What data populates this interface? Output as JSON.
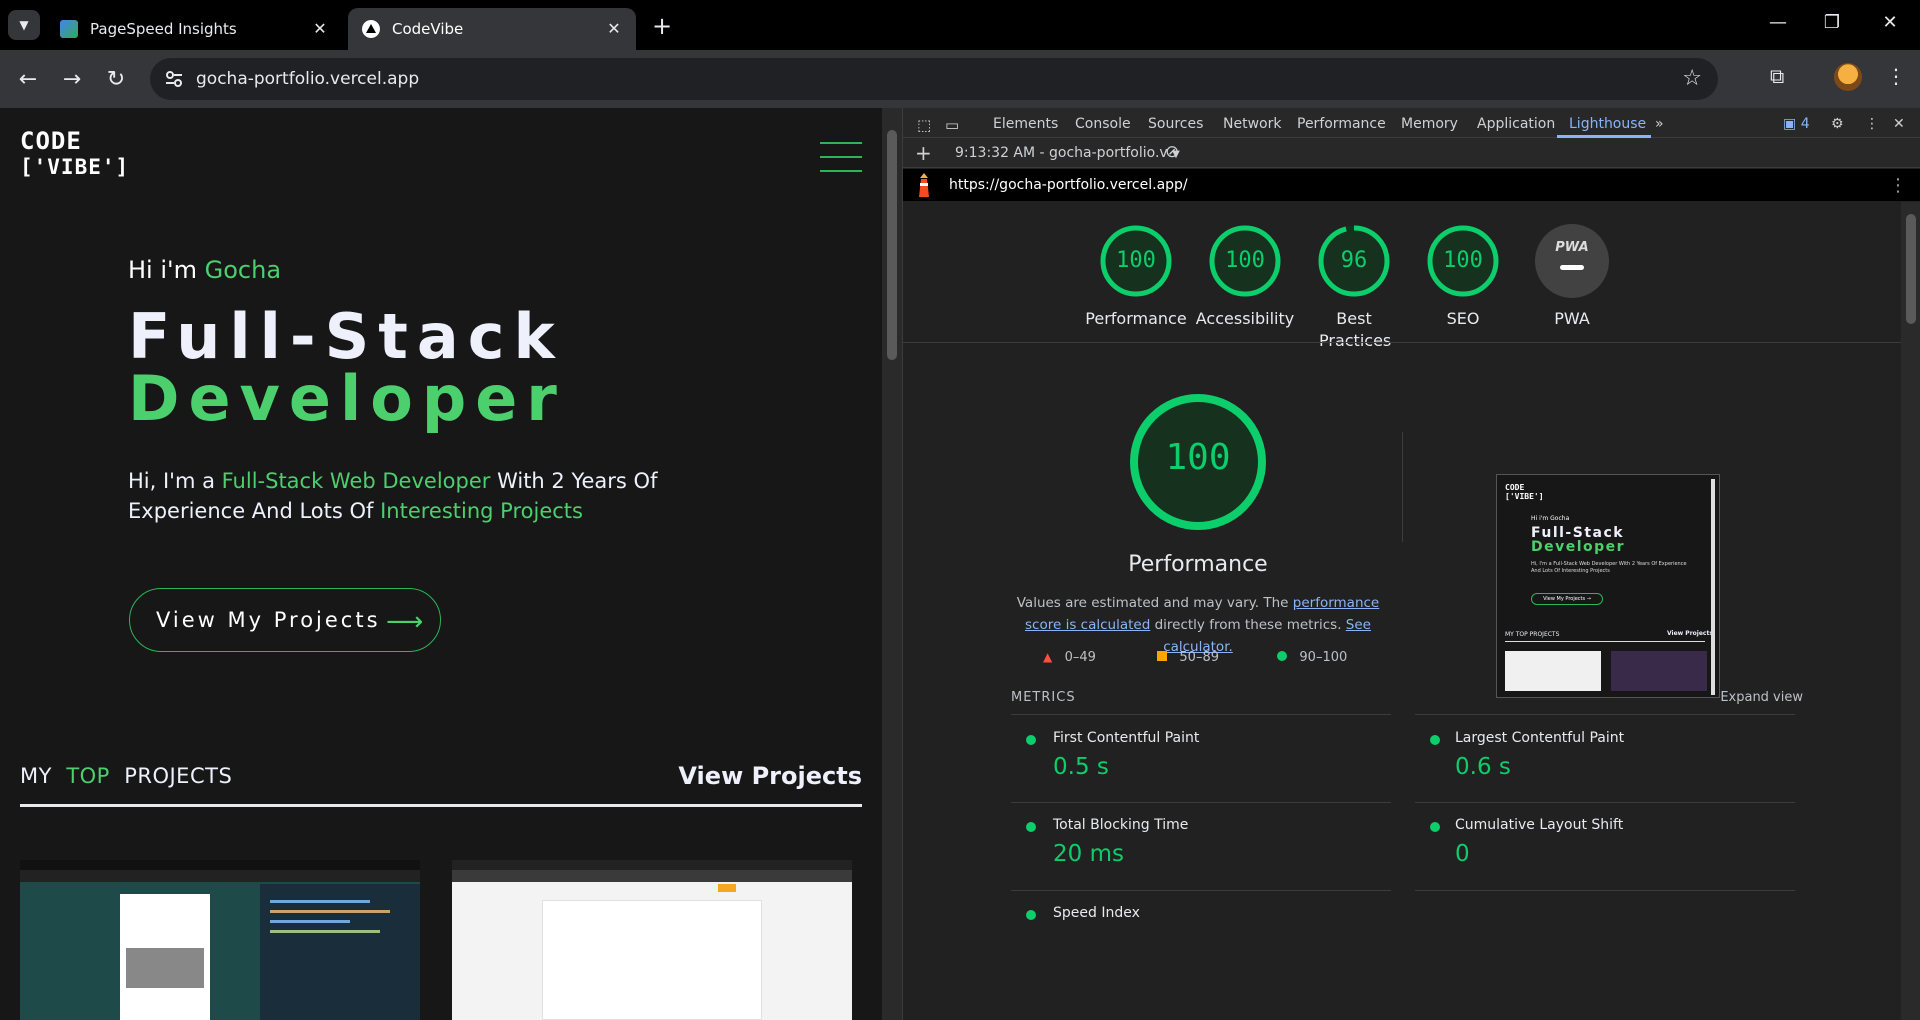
{
  "browser": {
    "tabs": [
      {
        "title": "PageSpeed Insights",
        "active": false
      },
      {
        "title": "CodeVibe",
        "active": true
      }
    ],
    "address": "gocha-portfolio.vercel.app"
  },
  "page": {
    "logo_line1": "CODE",
    "logo_line2": "['VIBE']",
    "greeting_prefix": "Hi i'm",
    "greeting_name": "Gocha",
    "title_line1": "Full-Stack",
    "title_line2": "Developer",
    "desc_part1": "Hi, I'm a ",
    "desc_highlight1": "Full-Stack Web Developer",
    "desc_part2": " With 2 Years Of Experience And Lots Of ",
    "desc_highlight2": "Interesting Projects",
    "cta_label": "View My Projects",
    "projects_my": "MY",
    "projects_top": "TOP",
    "projects_projects": "PROJECTS",
    "projects_link": "View Projects"
  },
  "devtools": {
    "tabs": [
      "Elements",
      "Console",
      "Sources",
      "Network",
      "Performance",
      "Memory",
      "Application",
      "Lighthouse"
    ],
    "active_tab": "Lighthouse",
    "issues_count": "4",
    "report_selector": "9:13:32 AM - gocha-portfolio.v",
    "report_url": "https://gocha-portfolio.vercel.app/"
  },
  "lighthouse": {
    "scores": [
      {
        "label": "Performance",
        "value": "100",
        "fraction": 1.0
      },
      {
        "label": "Accessibility",
        "value": "100",
        "fraction": 1.0
      },
      {
        "label": "Best Practices",
        "value": "96",
        "fraction": 0.96
      },
      {
        "label": "SEO",
        "value": "100",
        "fraction": 1.0
      },
      {
        "label": "PWA",
        "value": ""
      }
    ],
    "pwa_badge": "PWA",
    "main_score": "100",
    "main_label": "Performance",
    "note_part1": "Values are estimated and may vary. The ",
    "note_link1": "performance score is calculated",
    "note_part2": " directly from these metrics. ",
    "note_link2": "See calculator.",
    "legend": [
      "0–49",
      "50–89",
      "90–100"
    ],
    "metrics_title": "METRICS",
    "expand_label": "Expand view",
    "metrics": [
      {
        "name": "First Contentful Paint",
        "value": "0.5 s"
      },
      {
        "name": "Largest Contentful Paint",
        "value": "0.6 s"
      },
      {
        "name": "Total Blocking Time",
        "value": "20 ms"
      },
      {
        "name": "Cumulative Layout Shift",
        "value": "0"
      },
      {
        "name": "Speed Index",
        "value": ""
      }
    ],
    "thumb_greeting": "Hi i'm Gocha",
    "thumb_title1": "Full-Stack",
    "thumb_title2": "Developer",
    "thumb_desc": "Hi, I'm a Full-Stack Web Developer With 2 Years Of Experience And Lots Of Interesting Projects",
    "thumb_cta": "View My Projects →",
    "thumb_projects": "MY TOP PROJECTS",
    "thumb_view": "View Projects"
  },
  "colors": {
    "accent_green": "#4ccf6d",
    "lighthouse_pass": "#0cce6b",
    "link_blue": "#8ab4f8"
  }
}
